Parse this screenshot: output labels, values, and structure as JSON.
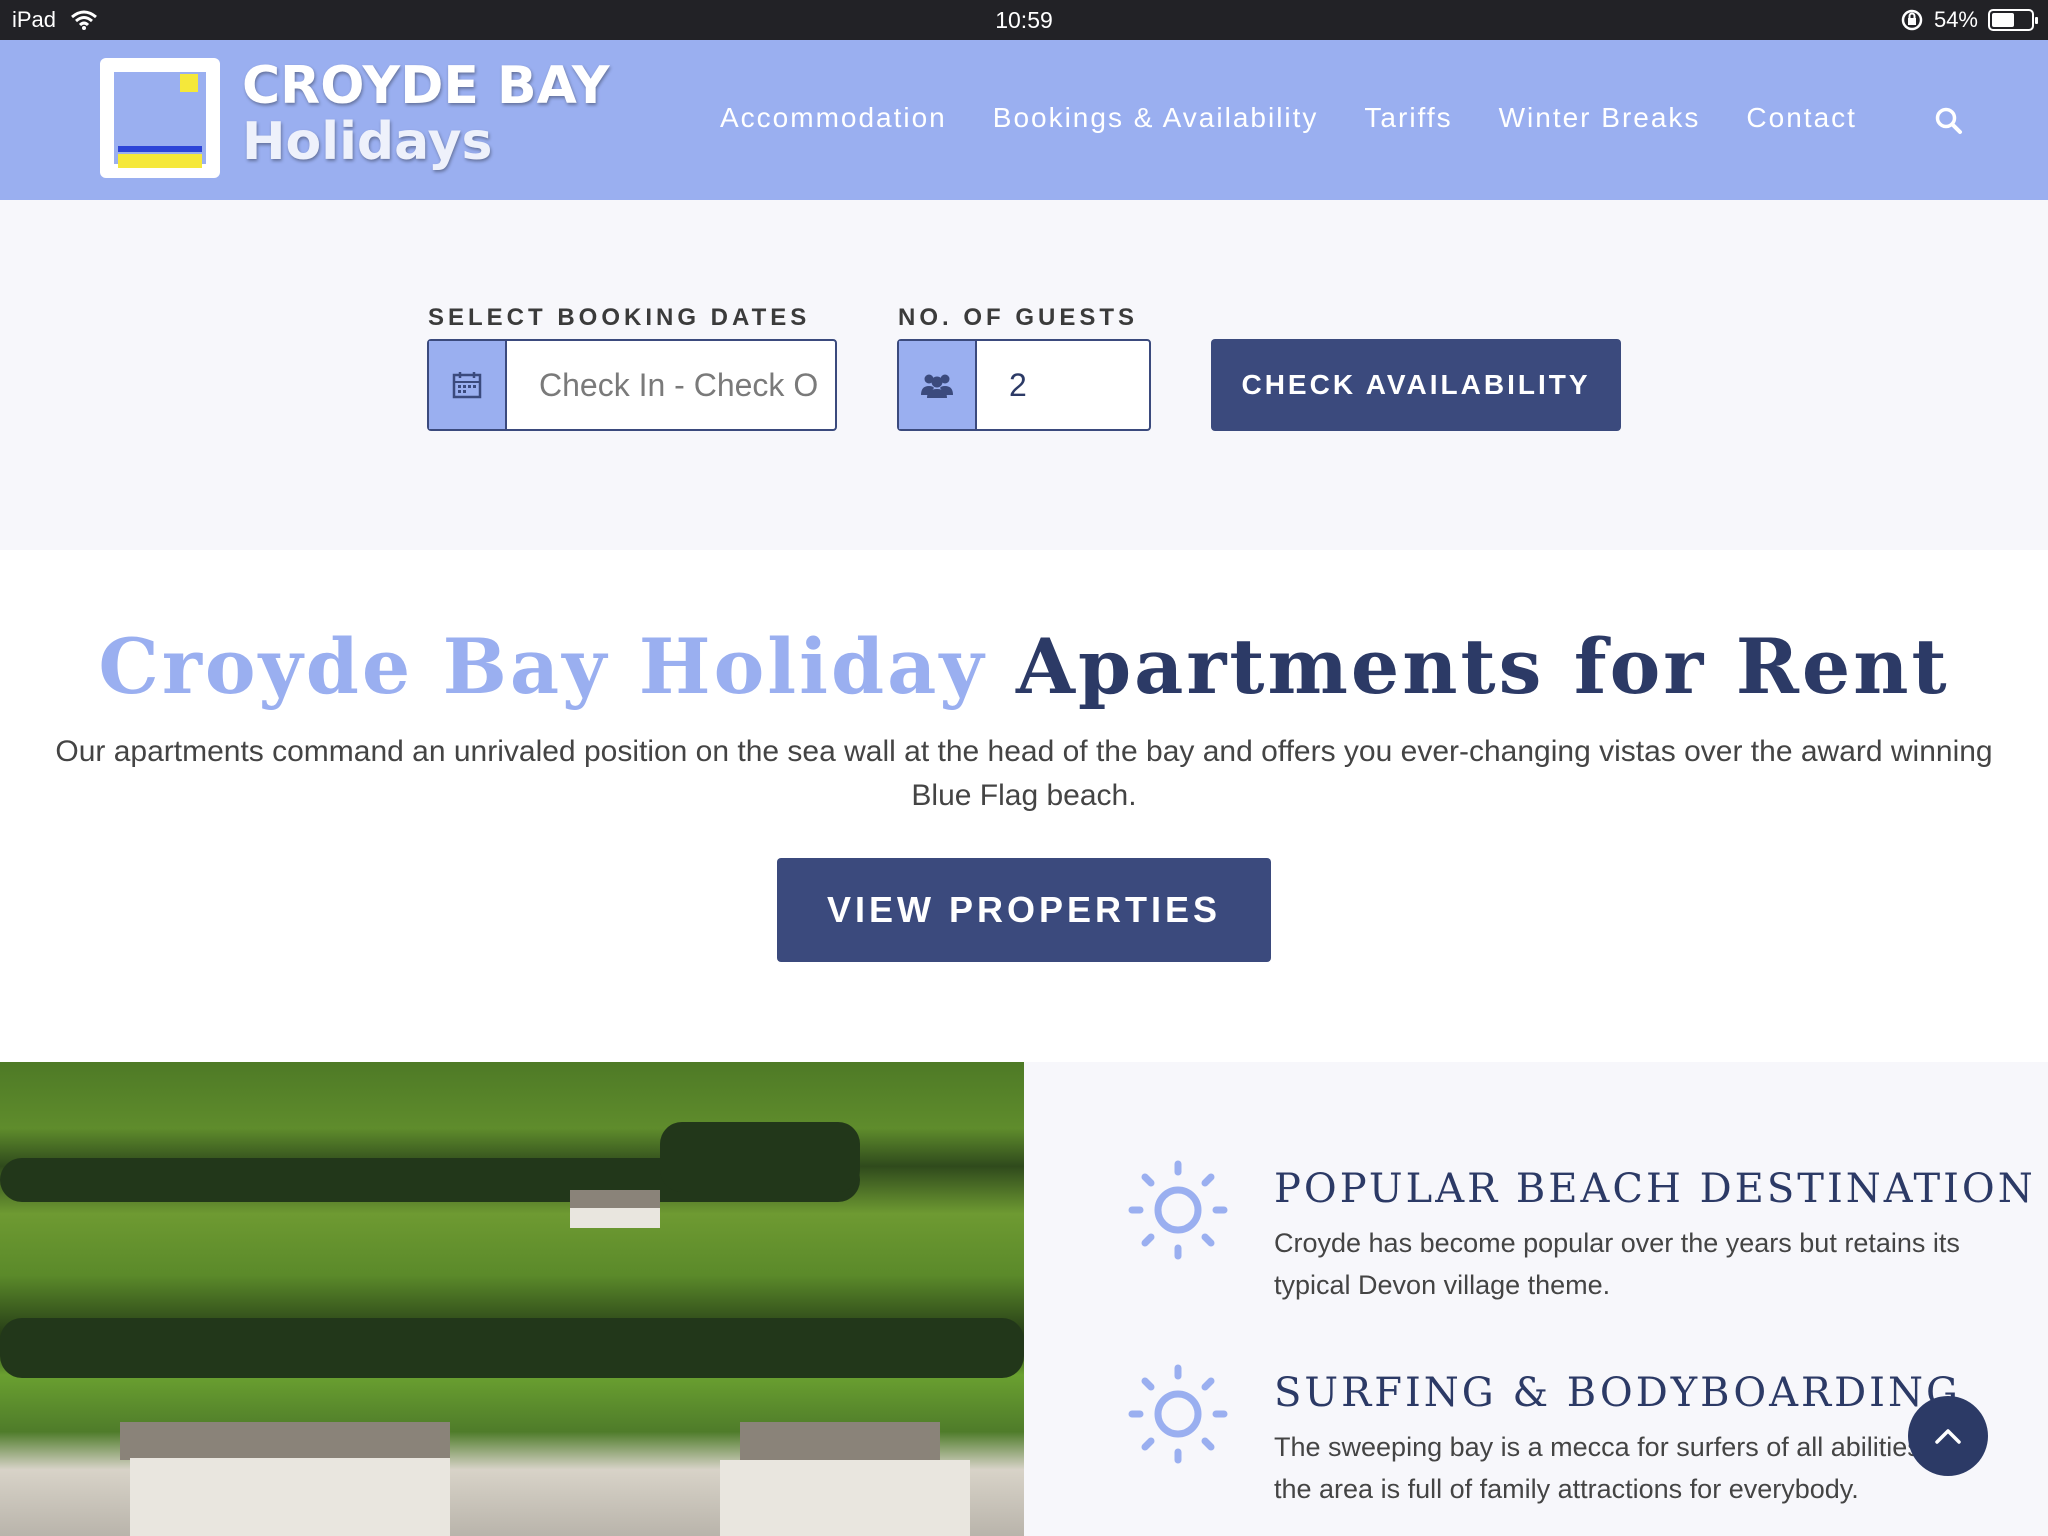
{
  "status_bar": {
    "device": "iPad",
    "time": "10:59",
    "battery": "54%",
    "battery_level": 0.54,
    "icons": [
      "wifi-icon",
      "rotation-lock-icon",
      "battery-icon"
    ]
  },
  "header": {
    "brand_line1": "CROYDE BAY",
    "brand_line2": "Holidays",
    "nav": [
      "Accommodation",
      "Bookings & Availability",
      "Tariffs",
      "Winter Breaks",
      "Contact"
    ],
    "search_icon": "search-icon"
  },
  "booking": {
    "dates_label": "SELECT BOOKING DATES",
    "dates_placeholder": "Check In - Check O",
    "guests_label": "NO. OF GUESTS",
    "guests_value": "2",
    "check_button": "CHECK AVAILABILITY",
    "icons": [
      "calendar-icon",
      "users-icon"
    ]
  },
  "intro": {
    "title_light": "Croyde Bay Holiday",
    "title_dark": "Apartments for Rent",
    "text": "Our apartments command an unrivaled position on the sea wall at the head of the bay and offers you ever-changing vistas over the award winning Blue Flag beach.",
    "button": "VIEW PROPERTIES"
  },
  "features": [
    {
      "icon": "sun-icon",
      "title": "POPULAR BEACH DESTINATION",
      "text": "Croyde has become popular over the years but retains its typical Devon village theme."
    },
    {
      "icon": "sun-icon",
      "title": "SURFING & BODYBOARDING",
      "text": "The sweeping bay is a mecca for surfers of all abilities and the area is full of family attractions for everybody."
    }
  ],
  "scroll_top_icon": "chevron-up-icon",
  "colors": {
    "accent_light": "#9aaff0",
    "accent_dark": "#3b4a7d",
    "title_dark": "#2c3a66",
    "status_bar": "#222226"
  }
}
